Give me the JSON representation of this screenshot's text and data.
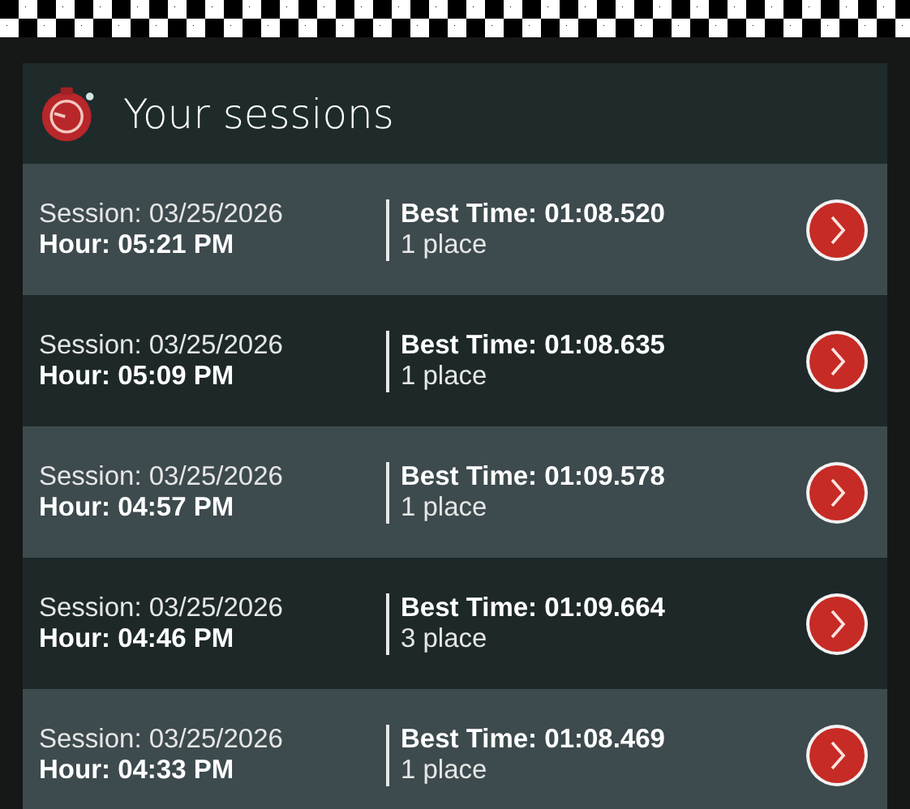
{
  "header": {
    "title": "Your sessions"
  },
  "sessions": [
    {
      "session": "Session: 03/25/2026",
      "hour": "Hour: 05:21 PM",
      "best_time": "Best Time: 01:08.520",
      "place": "1 place"
    },
    {
      "session": "Session: 03/25/2026",
      "hour": "Hour: 05:09 PM",
      "best_time": "Best Time: 01:08.635",
      "place": "1 place"
    },
    {
      "session": "Session: 03/25/2026",
      "hour": "Hour: 04:57 PM",
      "best_time": "Best Time: 01:09.578",
      "place": "1 place"
    },
    {
      "session": "Session: 03/25/2026",
      "hour": "Hour: 04:46 PM",
      "best_time": "Best Time: 01:09.664",
      "place": "3 place"
    },
    {
      "session": "Session: 03/25/2026",
      "hour": "Hour: 04:33 PM",
      "best_time": "Best Time: 01:08.469",
      "place": "1 place"
    }
  ]
}
